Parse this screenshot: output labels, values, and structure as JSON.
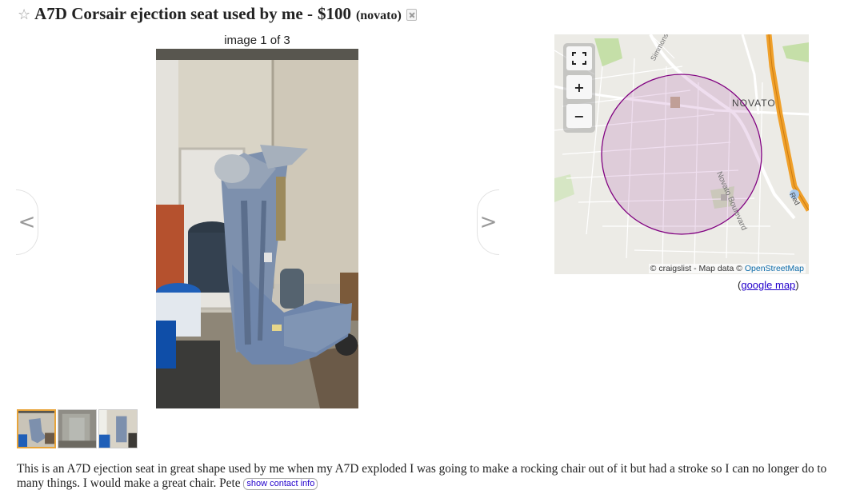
{
  "post": {
    "star_icon": "☆",
    "title": "A7D Corsair ejection seat used by me -",
    "price": "$100",
    "location": "(novato)"
  },
  "gallery": {
    "counter": "image 1 of 3",
    "prev_label": "<",
    "next_label": ">",
    "thumbnail_count": 3,
    "selected_thumbnail": 1
  },
  "map": {
    "fullscreen_icon": "fullscreen-icon",
    "zoom_in": "+",
    "zoom_out": "−",
    "labels": {
      "city": "NOVATO",
      "road_1": "Novato Boulevard",
      "road_2": "Simmons",
      "road_3": "Red"
    },
    "attribution_prefix": "© craigslist - Map data ©",
    "attribution_link": "OpenStreetMap",
    "google_prefix": "(",
    "google_link": "google map",
    "google_suffix": ")",
    "circle_color": "#800080"
  },
  "body": {
    "text": "This is an A7D ejection seat in great shape used by me when my A7D exploded I was going to make a rocking chair out of it but had a stroke so I can no longer do to many things. I would make a great chair. Pete",
    "contact_button": "show contact info"
  },
  "colors": {
    "link": "#2200cc",
    "thumb_selected_border": "#e8a43a",
    "highway": "#f0a02a"
  }
}
